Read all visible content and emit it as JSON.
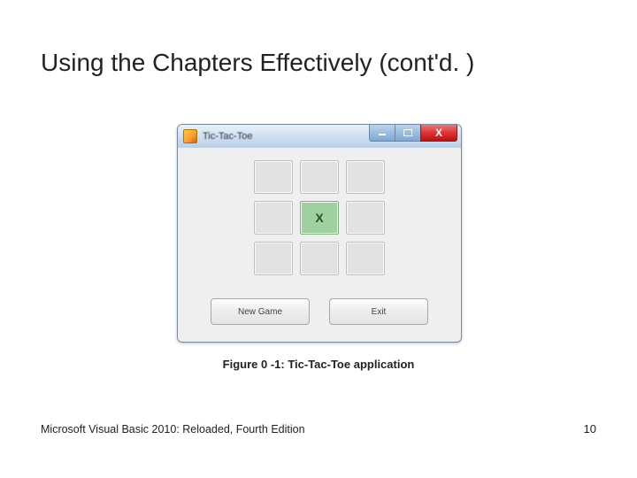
{
  "slide": {
    "title": "Using the Chapters Effectively (cont'd. )",
    "caption": "Figure 0 -1: Tic-Tac-Toe application",
    "footer_left": "Microsoft Visual Basic 2010: Reloaded, Fourth Edition",
    "page_number": "10"
  },
  "window": {
    "title": "Tic-Tac-Toe",
    "close_glyph": "X",
    "cells": [
      "",
      "",
      "",
      "",
      "X",
      "",
      "",
      "",
      ""
    ],
    "marked_index": 4,
    "buttons": {
      "new_game": "New Game",
      "exit": "Exit"
    }
  }
}
